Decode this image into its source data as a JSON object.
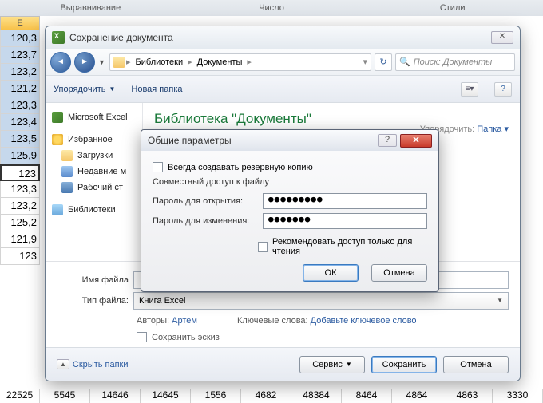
{
  "ribbon_groups": [
    "Выравнивание",
    "Число",
    "Стили"
  ],
  "column_header": "E",
  "left_cells": [
    "120,3",
    "123,7",
    "123,2",
    "121,2",
    "123,3",
    "123,4",
    "123,5",
    "125,9",
    "123",
    "123,3",
    "123,2",
    "125,2",
    "121,9",
    "123"
  ],
  "bottom_row": [
    "22525",
    "5545",
    "14646",
    "14645",
    "1556",
    "4682",
    "48384",
    "8464",
    "4864",
    "4863",
    "3330"
  ],
  "save_dialog": {
    "title": "Сохранение документа",
    "breadcrumb": [
      "Библиотеки",
      "Документы"
    ],
    "search_placeholder": "Поиск: Документы",
    "toolbar": {
      "organize": "Упорядочить",
      "new_folder": "Новая папка"
    },
    "sidebar": {
      "brand": "Microsoft Excel",
      "favorites": "Избранное",
      "items_fav": [
        "Загрузки",
        "Недавние м",
        "Рабочий ст"
      ],
      "libraries": "Библиотеки"
    },
    "main": {
      "lib_title": "Библиотека \"Документы\"",
      "sort_label": "Упорядочить:",
      "sort_value": "Папка"
    },
    "form": {
      "filename_label": "Имя файла",
      "filename_value": "",
      "filetype_label": "Тип файла:",
      "filetype_value": "Книга Excel",
      "authors_label": "Авторы:",
      "authors_value": "Артем",
      "keywords_label": "Ключевые слова:",
      "keywords_value": "Добавьте ключевое слово",
      "save_thumb": "Сохранить эскиз"
    },
    "footer": {
      "hide_folders": "Скрыть папки",
      "tools_btn": "Сервис",
      "save_btn": "Сохранить",
      "cancel_btn": "Отмена"
    }
  },
  "options_dialog": {
    "title": "Общие параметры",
    "always_backup": "Всегда создавать резервную копию",
    "shared_access": "Совместный доступ к файлу",
    "pwd_open_label": "Пароль для открытия:",
    "pwd_open_value": "●●●●●●●●●",
    "pwd_mod_label": "Пароль для изменения:",
    "pwd_mod_value": "●●●●●●●",
    "readonly_rec": "Рекомендовать доступ только для чтения",
    "ok": "ОК",
    "cancel": "Отмена"
  }
}
